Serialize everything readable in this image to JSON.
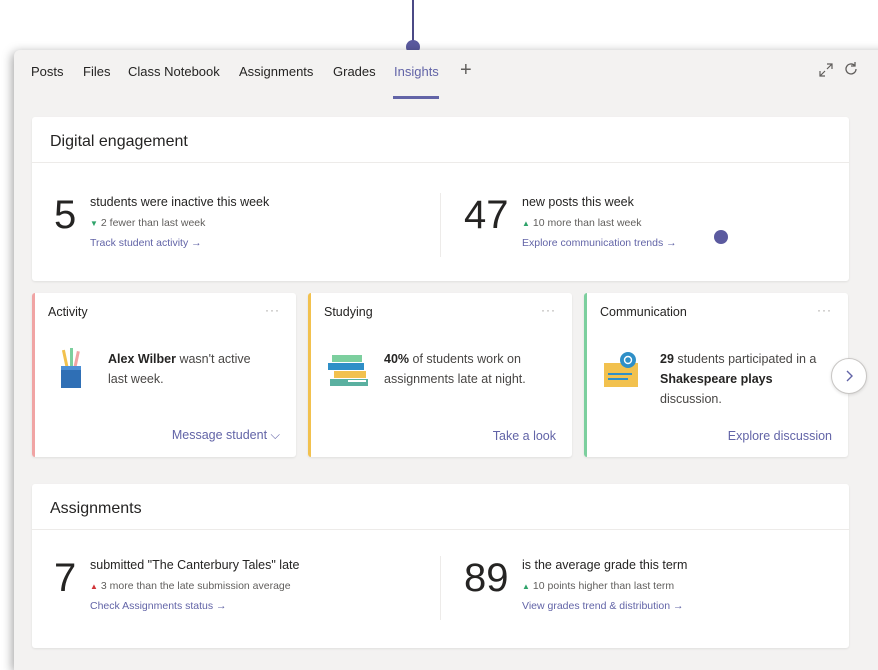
{
  "tabs": [
    {
      "label": "Posts"
    },
    {
      "label": "Files"
    },
    {
      "label": "Class Notebook"
    },
    {
      "label": "Assignments"
    },
    {
      "label": "Grades"
    },
    {
      "label": "Insights"
    }
  ],
  "active_tab": "Insights",
  "add_tab_symbol": "+",
  "icons": [
    "plus-icon",
    "expand-icon",
    "refresh-icon",
    "chevron-right-icon",
    "more-icon"
  ],
  "colors": {
    "accent": "#6264a7",
    "activity_bar": "#f0a4a4",
    "studying_bar": "#f2c14e",
    "communication_bar": "#7ccf9e",
    "delta_up_good": "#2fa36a",
    "delta_up_bad": "#d13438"
  },
  "digital_engagement": {
    "title": "Digital engagement",
    "left": {
      "number": "5",
      "headline": "students were inactive this week",
      "delta_symbol": "▼",
      "delta": "2 fewer than last week",
      "link": "Track student activity →"
    },
    "right": {
      "number": "47",
      "headline": "new posts this week",
      "delta_symbol": "▲",
      "delta": "10 more than last week",
      "link": "Explore communication trends →"
    }
  },
  "insight_cards": [
    {
      "title": "Activity",
      "more": "···",
      "text_bold": "Alex Wilber",
      "text": " wasn't active last week.",
      "action": "Message student ⌵"
    },
    {
      "title": "Studying",
      "more": "···",
      "text_bold": "40%",
      "text": " of students work on assignments late at night.",
      "action": "Take a look"
    },
    {
      "title": "Communication",
      "more": "···",
      "text_bold": "29",
      "text_mid": " students participated in a ",
      "text_bold2": "Shakespeare plays",
      "text_end": " discussion.",
      "action": "Explore discussion"
    }
  ],
  "assignments": {
    "title": "Assignments",
    "left": {
      "number": "7",
      "headline": "submitted \"The Canterbury Tales\" late",
      "delta_symbol": "▲",
      "delta": "3 more than the late submission average",
      "link": "Check Assignments status →"
    },
    "right": {
      "number": "89",
      "headline": "is the average grade this term",
      "delta_symbol": "▲",
      "delta": "10 points higher than last term",
      "link": "View grades trend & distribution →"
    }
  }
}
